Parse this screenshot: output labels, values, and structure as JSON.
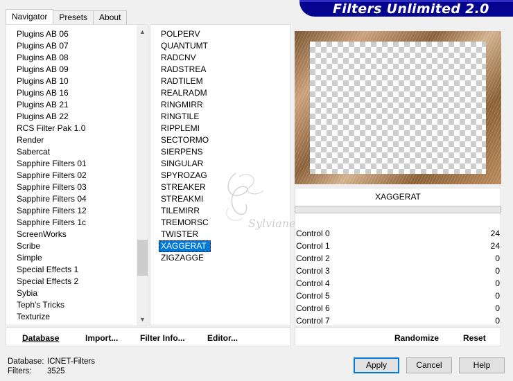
{
  "tabs": [
    "Navigator",
    "Presets",
    "About"
  ],
  "banner_title": "Filters Unlimited 2.0",
  "categories": [
    "Plugins AB 06",
    "Plugins AB 07",
    "Plugins AB 08",
    "Plugins AB 09",
    "Plugins AB 10",
    "Plugins AB 16",
    "Plugins AB 21",
    "Plugins AB 22",
    "RCS Filter Pak 1.0",
    "Render",
    "Sabercat",
    "Sapphire Filters 01",
    "Sapphire Filters 02",
    "Sapphire Filters 03",
    "Sapphire Filters 04",
    "Sapphire Filters 12",
    "Sapphire Filters 1c",
    "ScreenWorks",
    "Scribe",
    "Simple",
    "Special Effects 1",
    "Special Effects 2",
    "Sybia",
    "Teph's Tricks",
    "Texturize"
  ],
  "scroll_icons": {
    "up": "▲",
    "down": "▼"
  },
  "filters": [
    "POLPERV",
    "QUANTUMT",
    "RADCNV",
    "RADSTREA",
    "RADTILEM",
    "REALRADM",
    "RINGMIRR",
    "RINGTILE",
    "RIPPLEMI",
    "SECTORMO",
    "SIERPENS",
    "SINGULAR",
    "SPYROZAG",
    "STREAKER",
    "STREAKMI",
    "TILEMIRR",
    "TREMORSC",
    "TWISTER",
    "XAGGERAT",
    "ZIGZAGGE"
  ],
  "selected_filter": "XAGGERAT",
  "watermark_text": "Sylviane",
  "controls": [
    {
      "name": "Control 0",
      "value": "24"
    },
    {
      "name": "Control 1",
      "value": "24"
    },
    {
      "name": "Control 2",
      "value": "0"
    },
    {
      "name": "Control 3",
      "value": "0"
    },
    {
      "name": "Control 4",
      "value": "0"
    },
    {
      "name": "Control 5",
      "value": "0"
    },
    {
      "name": "Control 6",
      "value": "0"
    },
    {
      "name": "Control 7",
      "value": "0"
    }
  ],
  "bottom_left": {
    "database": "Database",
    "import": "Import...",
    "filter_info": "Filter Info...",
    "editor": "Editor..."
  },
  "bottom_right": {
    "randomize": "Randomize",
    "reset": "Reset"
  },
  "status": {
    "db_label": "Database:",
    "db_value": "ICNET-Filters",
    "filters_label": "Filters:",
    "filters_value": "3525"
  },
  "buttons": {
    "apply": "Apply",
    "cancel": "Cancel",
    "help": "Help"
  }
}
